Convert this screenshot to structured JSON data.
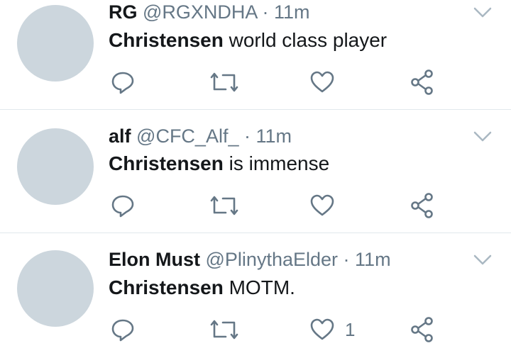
{
  "tweets": [
    {
      "name": "RG",
      "handle": "@RGXNDHA",
      "separator": "·",
      "time": "11m",
      "text_bold": "Christensen",
      "text_rest": " world class player",
      "like_count": ""
    },
    {
      "name": "alf",
      "handle": "@CFC_Alf_",
      "separator": "·",
      "time": "11m",
      "text_bold": "Christensen",
      "text_rest": " is immense",
      "like_count": ""
    },
    {
      "name": "Elon Must",
      "handle": "@PlinythaElder",
      "separator": "·",
      "time": "11m",
      "text_bold": "Christensen",
      "text_rest": " MOTM.",
      "like_count": "1"
    }
  ],
  "icons": {
    "reply": "reply-icon",
    "retweet": "retweet-icon",
    "like": "heart-icon",
    "share": "share-icon",
    "caret": "chevron-down-icon"
  },
  "colors": {
    "text": "#14171a",
    "secondary": "#657786",
    "avatar": "#ccd6dd",
    "divider": "#e1e8ed",
    "icon": "#657786"
  }
}
